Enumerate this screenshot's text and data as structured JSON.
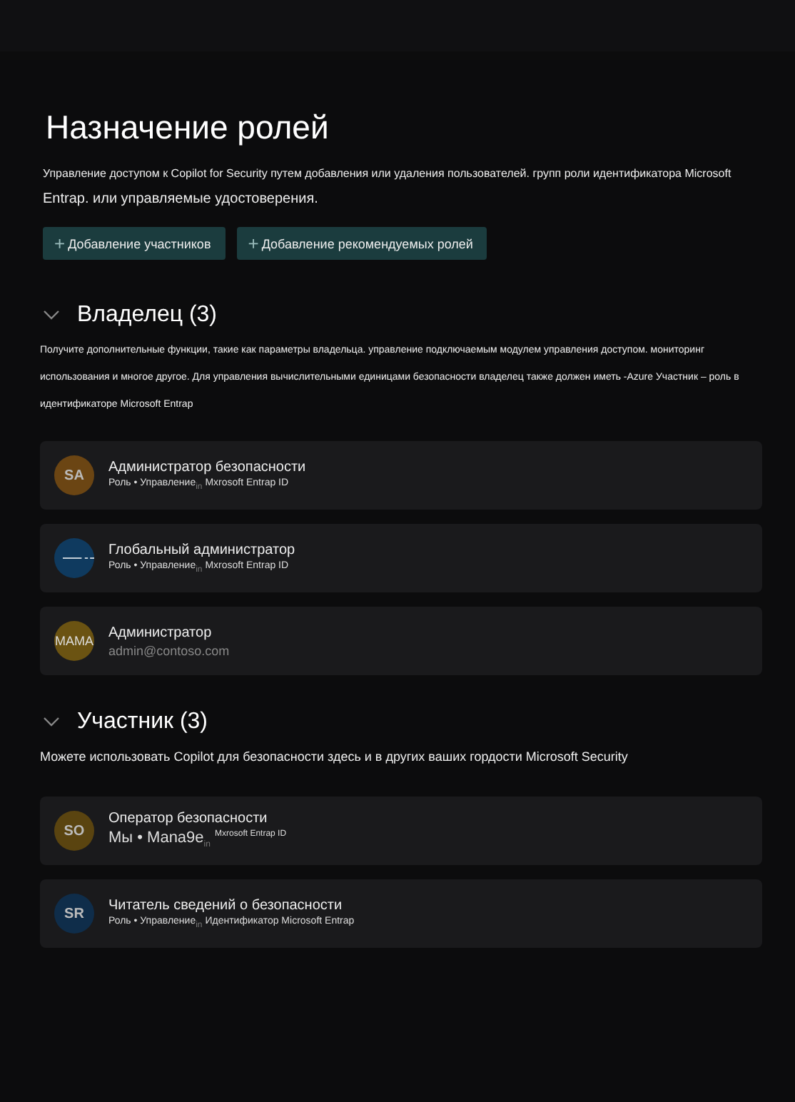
{
  "title": "Назначение ролей",
  "description": "Управление доступом к Copilot for Security путем добавления или удаления пользователей. групп роли идентификатора Microsoft",
  "description_2": "Entrap. или управляемые удостоверения.",
  "buttons": [
    {
      "icon": "+",
      "label": "Добавление участников"
    },
    {
      "icon": "+",
      "label": "Добавление рекомендуемых ролей"
    }
  ],
  "sections": [
    {
      "title": "Владелец (3)",
      "expanded": true,
      "description": "Получите дополнительные функции, такие как параметры владельца. управление подключаемым модулем управления доступом. мониторинг использования и многое другое. Для управления вычислительными единицами безопасности владелец также должен иметь -Azure Участник – роль в идентификаторе Microsoft Entrap",
      "kind": "fine",
      "members": [
        {
          "initials": "SA",
          "color": "#6b4513",
          "name": "Администратор безопасности",
          "subtitle": "Роль • Управление$_{in}$ Mxrosoft Entrap ID",
          "kind": "role"
        },
        {
          "kind": "role",
          "color": "#0f3a5f",
          "name": "Глобальный администратор",
          "subtitle": "Роль • Управление$_{in}$ Mxrosoft Entrap ID"
        },
        {
          "initials": "MAMA",
          "color": "#6b5312",
          "name": "Администратор",
          "subtitle": "admin@contoso.com",
          "kind": "email"
        }
      ]
    },
    {
      "title": "Участник (3)",
      "expanded": true,
      "description": "Можете использовать Copilot для безопасности здесь и в других ваших гордости Microsoft Security",
      "kind": "plain",
      "members": [
        {
          "initials": "SO",
          "color": "#5a4410",
          "name": "Оператор безопасности",
          "subtitle": "Мы • Mana9e$_{in}$ $^{Mxrosoft Entrap ID}$",
          "kind": "large"
        },
        {
          "initials": "SR",
          "color": "#0f2d4a",
          "name": "Читатель сведений о безопасности",
          "subtitle": "Роль • Управление$_{in}$ Идентификатор Microsoft Entrap",
          "kind": "role"
        }
      ]
    }
  ]
}
